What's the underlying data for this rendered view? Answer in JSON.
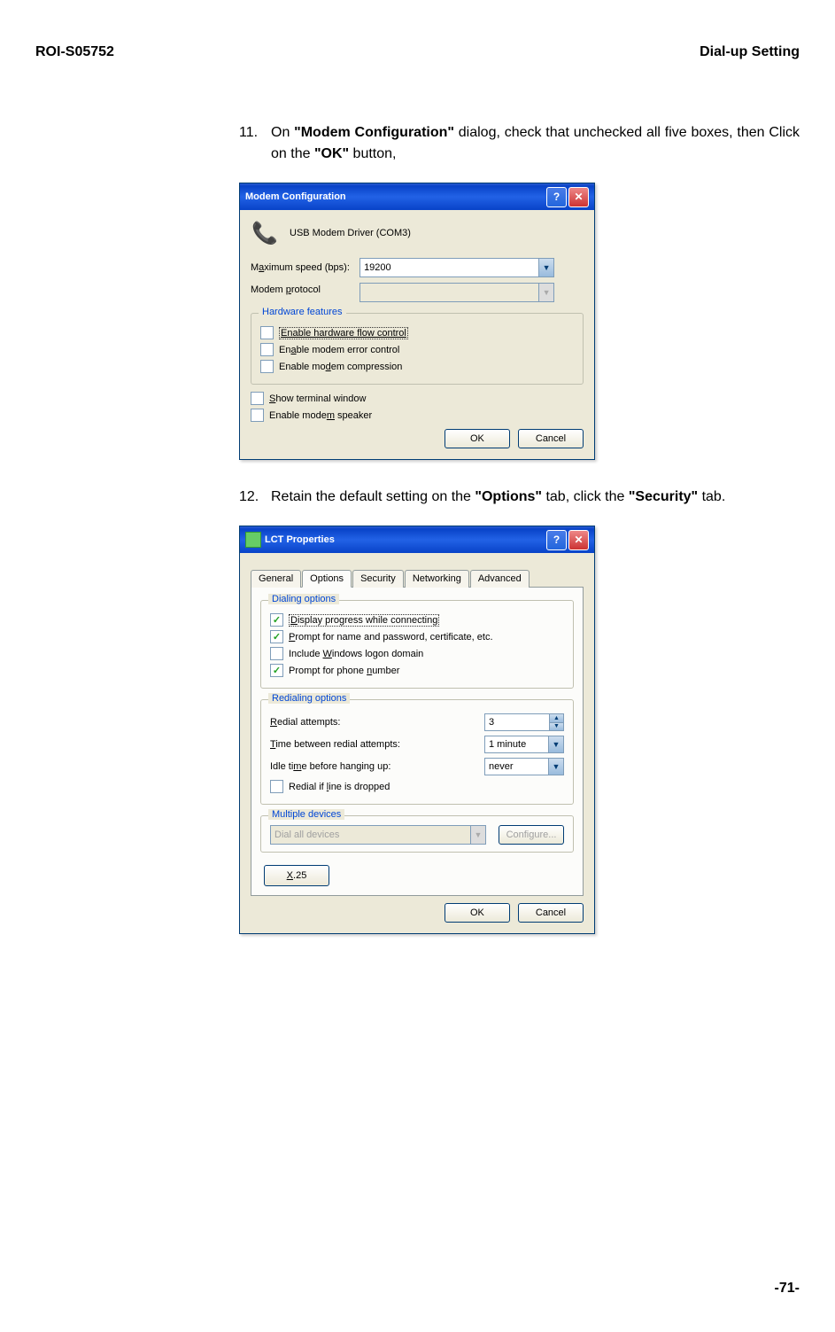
{
  "header": {
    "left": "ROI-S05752",
    "right": "Dial-up Setting"
  },
  "step11": {
    "num": "11.",
    "t1": "On ",
    "b1": "\"Modem Configuration\"",
    "t2": " dialog, check that unchecked all five boxes, then Click on the ",
    "b2": "\"OK\"",
    "t3": " button,"
  },
  "modemDlg": {
    "title": "Modem Configuration",
    "helpGlyph": "?",
    "closeGlyph": "✕",
    "driver": "USB Modem Driver (COM3)",
    "modemIcon": "📞",
    "maxSpeedLabelPre": "M",
    "maxSpeedLabelU": "a",
    "maxSpeedLabelPost": "ximum speed (bps):",
    "maxSpeedValue": "19200",
    "protoLabelPre": "Modem ",
    "protoLabelU": "p",
    "protoLabelPost": "rotocol",
    "groupTitle": "Hardware features",
    "cb1": "Enable hardware flow control",
    "cb2pre": "En",
    "cb2u": "a",
    "cb2post": "ble modem error control",
    "cb3pre": "Enable mo",
    "cb3u": "d",
    "cb3post": "em compression",
    "cb4pre": "",
    "cb4u": "S",
    "cb4post": "how terminal window",
    "cb5pre": "Enable mode",
    "cb5u": "m",
    "cb5post": " speaker",
    "ok": "OK",
    "cancel": "Cancel"
  },
  "step12": {
    "num": "12.",
    "t1": "Retain the default setting on the ",
    "b1": "\"Options\"",
    "t2": " tab, click the ",
    "b2": "\"Security\"",
    "t3": " tab."
  },
  "lctDlg": {
    "title": "LCT Properties",
    "helpGlyph": "?",
    "closeGlyph": "✕",
    "tabs": {
      "general": "General",
      "options": "Options",
      "security": "Security",
      "networking": "Networking",
      "advanced": "Advanced"
    },
    "dialGroup": "Dialing options",
    "d1pre": "",
    "d1u": "D",
    "d1post": "isplay progress while connecting",
    "d2pre": "",
    "d2u": "P",
    "d2post": "rompt for name and password, certificate, etc.",
    "d3pre": "Include ",
    "d3u": "W",
    "d3post": "indows logon domain",
    "d4pre": "Prompt for phone ",
    "d4u": "n",
    "d4post": "umber",
    "redialGroup": "Redialing options",
    "r1pre": "",
    "r1u": "R",
    "r1post": "edial attempts:",
    "r1val": "3",
    "r2pre": "",
    "r2u": "T",
    "r2post": "ime between redial attempts:",
    "r2val": "1 minute",
    "r3pre": "Idle ti",
    "r3u": "m",
    "r3post": "e before hanging up:",
    "r3val": "never",
    "r4pre": "Redial if ",
    "r4u": "l",
    "r4post": "ine is dropped",
    "multiGroup": "Multiple devices",
    "multiCombo": "Dial all devices",
    "configureBtn": "Configure...",
    "x25pre": "",
    "x25u": "X",
    "x25post": ".25",
    "ok": "OK",
    "cancel": "Cancel"
  },
  "footer": "-71-"
}
